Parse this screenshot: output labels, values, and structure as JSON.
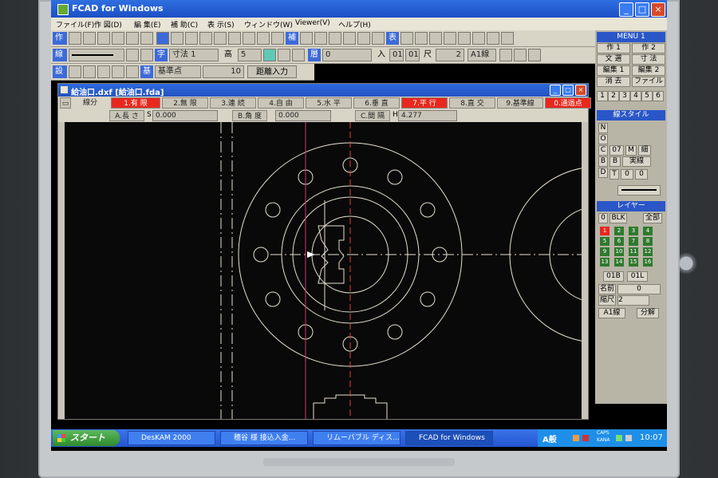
{
  "app": {
    "title": "FCAD for Windows"
  },
  "menu": [
    "ファイル(F)",
    "作 図(D)",
    "編 集(E)",
    "補 助(C)",
    "表 示(S)",
    "ウィンドウ(W)",
    "Viewer(V)",
    "ヘルプ(H)"
  ],
  "toolbar1": {
    "label": "作",
    "buttons": [
      "補",
      "表"
    ]
  },
  "toolbar2": {
    "label": "線",
    "type_btn": "字",
    "type_field": "寸法 1",
    "height_label": "高",
    "height_value": "5",
    "layer_label": "層",
    "layer_value": "0",
    "in_label": "入",
    "in_values": [
      "01",
      "01"
    ],
    "scale_label": "尺",
    "scale_value": "2",
    "font_label": "A1線"
  },
  "toolbar3": {
    "label": "設",
    "base_btn": "基",
    "base_label": "基準点",
    "value": "10",
    "distance_btn": "距離入力"
  },
  "subwindow": {
    "title": "給油口.dxf [給油口.fda]"
  },
  "modes": {
    "label": "線分",
    "items": [
      "1.有 限",
      "2.無 限",
      "3.連 続",
      "4.自 由",
      "5.水 平",
      "6.垂 直",
      "7.平 行",
      "8.直 交",
      "9.基準線",
      "0.通過点"
    ],
    "active": [
      true,
      false,
      false,
      false,
      false,
      false,
      true,
      false,
      false,
      true
    ]
  },
  "inputs": {
    "a_label": "A.長 さ",
    "s_label": "S",
    "a_value": "0.000",
    "b_label": "B.角 度",
    "b_value": "0.000",
    "c_label": "C.間 隔",
    "h_label": "H",
    "c_value": "4.277"
  },
  "right_panel": {
    "menu_title": "MENU 1",
    "menu_buttons": [
      "作 1",
      "作 2",
      "文 選",
      "寸 法",
      "編集 1",
      "編集 2",
      "消 去",
      "ファイル"
    ],
    "number_tabs": [
      "1",
      "2",
      "3",
      "4",
      "5",
      "6"
    ],
    "line_style_title": "線スタイル",
    "line_buttons": [
      "N",
      "O",
      "C",
      "B",
      "D",
      "07",
      "M",
      "細",
      "B",
      "実線",
      "T",
      "0",
      "0"
    ],
    "layer_title": "レイヤー",
    "layer_buttons": [
      "0",
      "BLK",
      "全部"
    ],
    "layers": [
      "1",
      "2",
      "3",
      "4",
      "5",
      "6",
      "7",
      "8",
      "9",
      "10",
      "11",
      "12",
      "13",
      "14",
      "15",
      "16"
    ],
    "layer_ops": [
      "01B",
      "01L"
    ],
    "name_label": "名前",
    "name_value": "0",
    "scale_label": "縮尺",
    "scale_value": "2",
    "font_label": "A1線",
    "split_label": "分解"
  },
  "taskbar": {
    "start": "スタート",
    "tasks": [
      "DesKAM 2000",
      "穂谷 様 接込入金...",
      "リムーバブル ディス...",
      "FCAD for Windows"
    ],
    "ime": "A般",
    "caps": "CAPS",
    "kana": "KANA",
    "time": "10:07"
  },
  "colors": {
    "title_blue": "#2a5fd6",
    "active_red": "#e8281e",
    "layer_green": "#2f7a2f",
    "drawing": "#e7e0cf",
    "construction_red": "#e04040"
  },
  "icons": {
    "window": "fcad-app-icon",
    "start": "windows-logo-icon"
  }
}
